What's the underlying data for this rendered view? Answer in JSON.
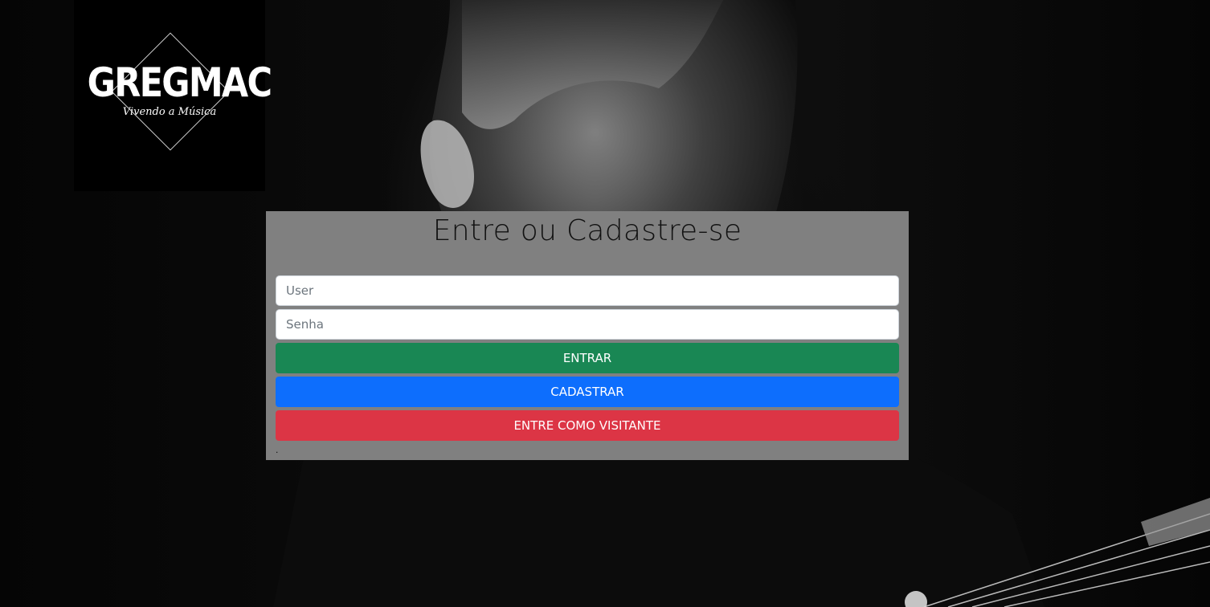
{
  "logo": {
    "title": "GREGMAC",
    "subtitle": "Vivendo a Música"
  },
  "login": {
    "heading": "Entre ou Cadastre-se",
    "user_placeholder": "User",
    "password_placeholder": "Senha",
    "enter_label": "ENTRAR",
    "register_label": "CADASTRAR",
    "guest_label": "ENTRE COMO VISITANTE",
    "footer_text": "."
  },
  "colors": {
    "enter_button": "#198754",
    "register_button": "#0d6efd",
    "guest_button": "#dc3545",
    "panel_background": "#808080"
  }
}
